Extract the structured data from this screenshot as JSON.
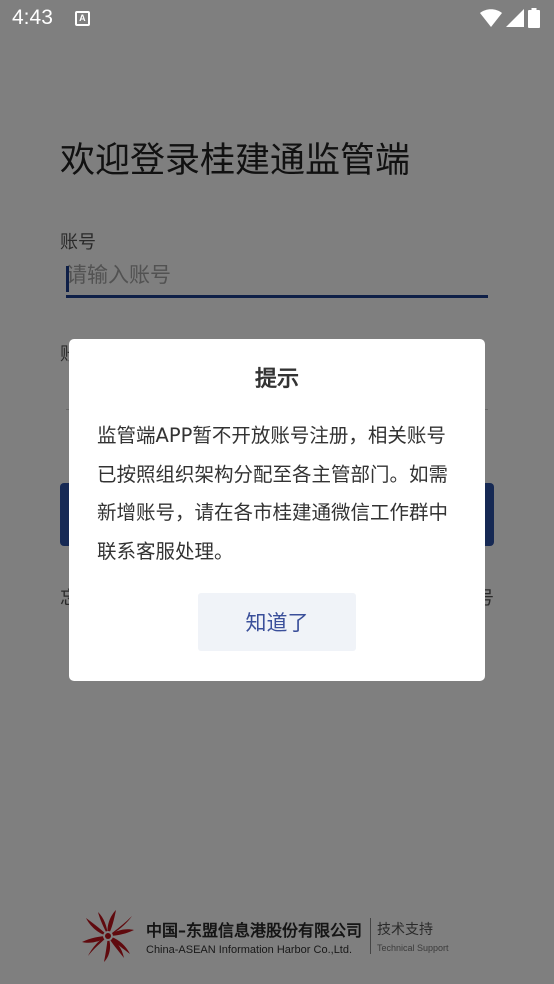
{
  "status_bar": {
    "time": "4:43",
    "app_icon_letter": "A",
    "icons": [
      "wifi-icon",
      "signal-icon",
      "battery-icon"
    ]
  },
  "login": {
    "title": "欢迎登录桂建通监管端",
    "account_label": "账号",
    "account_placeholder": "请输入账号",
    "password_label_partial": "账",
    "forgot_partial": "忘",
    "register_partial": "号"
  },
  "dialog": {
    "title": "提示",
    "message": "监管端APP暂不开放账号注册，相关账号已按照组织架构分配至各主管部门。如需新增账号，请在各市桂建通微信工作群中联系客服处理。",
    "ok_label": "知道了"
  },
  "footer": {
    "company_cn": "中国–东盟信息港股份有限公司",
    "company_en": "China-ASEAN Information Harbor Co.,Ltd.",
    "support_cn": "技术支持",
    "support_en": "Technical Support",
    "logo_icon": "company-logo-icon"
  },
  "colors": {
    "accent": "#1d3f8f",
    "dialog_button_bg": "#f0f3f8",
    "dialog_button_text": "#3a4f9a",
    "logo_red": "#c0151c"
  }
}
